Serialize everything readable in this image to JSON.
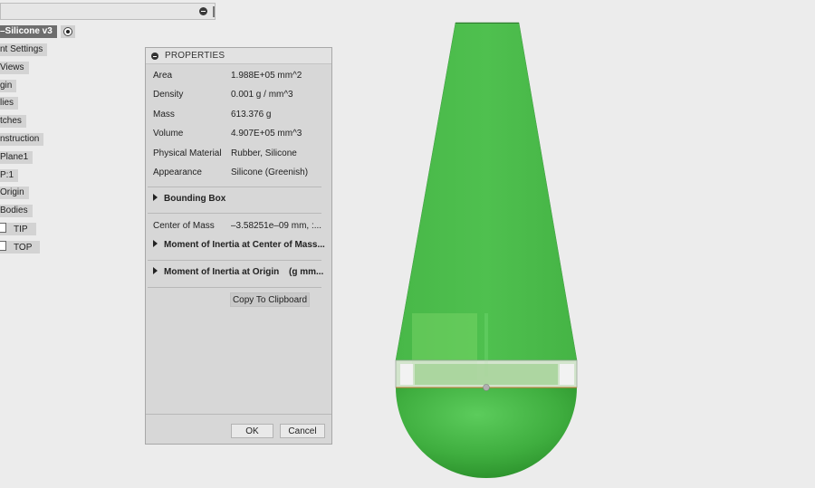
{
  "browser": {
    "root_label": "–Silicone v3",
    "items": [
      {
        "label": "nt Settings"
      },
      {
        "label": "Views"
      },
      {
        "label": "gin"
      },
      {
        "label": "lies"
      },
      {
        "label": "tches"
      },
      {
        "label": "nstruction"
      },
      {
        "label": "Plane1"
      },
      {
        "label": "P:1"
      },
      {
        "label": "Origin"
      },
      {
        "label": "Bodies"
      },
      {
        "label": "TIP"
      },
      {
        "label": "TOP"
      }
    ]
  },
  "properties": {
    "title": "PROPERTIES",
    "rows": [
      {
        "key": "Area",
        "value": "1.988E+05 mm^2"
      },
      {
        "key": "Density",
        "value": "0.001 g / mm^3"
      },
      {
        "key": "Mass",
        "value": "613.376 g"
      },
      {
        "key": "Volume",
        "value": "4.907E+05 mm^3"
      },
      {
        "key": "Physical Material",
        "value": "Rubber, Silicone"
      },
      {
        "key": "Appearance",
        "value": "Silicone (Greenish)"
      }
    ],
    "bounding_box_label": "Bounding Box",
    "center_of_mass_key": "Center of Mass",
    "center_of_mass_value": "–3.58251e–09 mm, :...",
    "moi_center_label": "Moment of Inertia at Center of Mass...",
    "moi_origin_label": "Moment of Inertia at Origin",
    "moi_origin_unit": "(g mm...",
    "copy_label": "Copy To Clipboard",
    "ok_label": "OK",
    "cancel_label": "Cancel"
  },
  "colors": {
    "model_green": "#4cb84c",
    "dialog_bg": "#d7d7d7",
    "viewport_bg": "#ececec"
  }
}
